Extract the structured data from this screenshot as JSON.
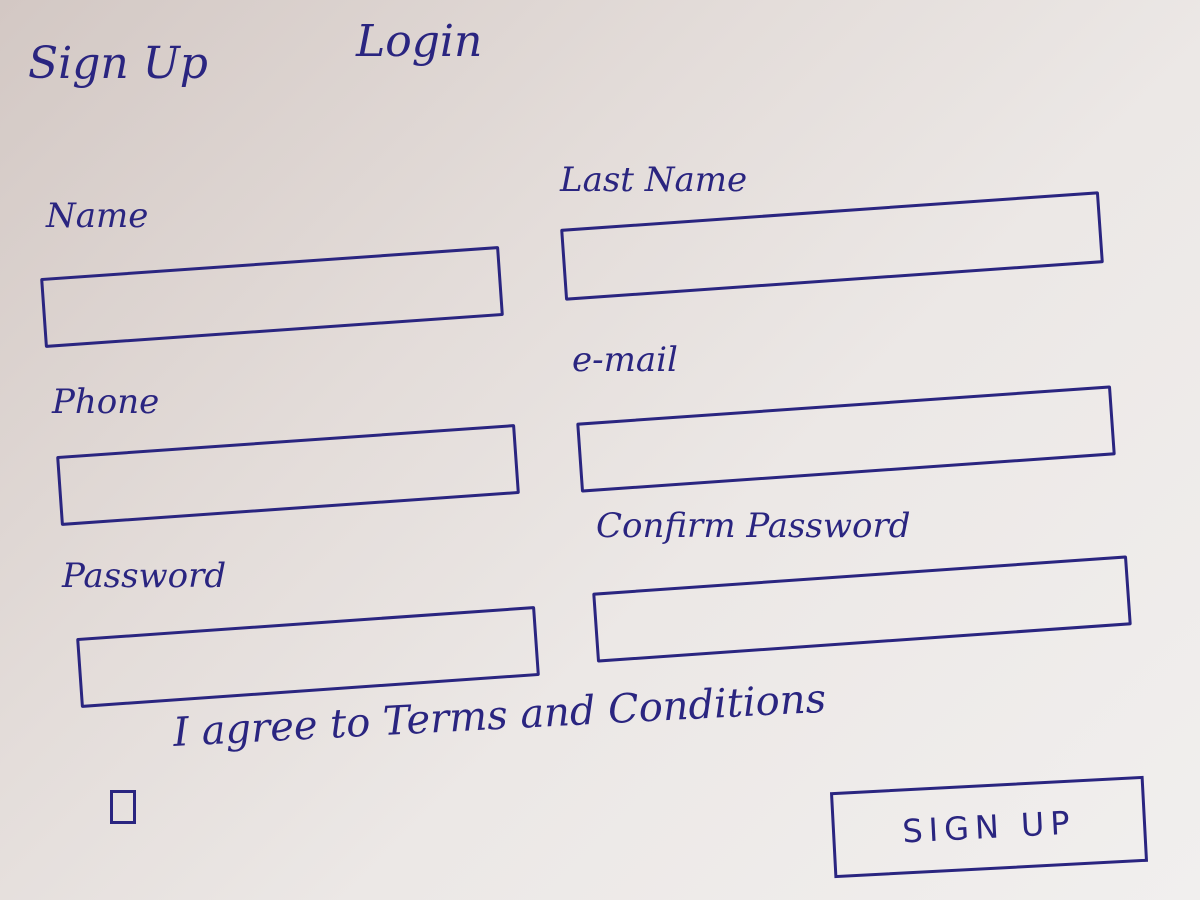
{
  "tabs": {
    "signup": "Sign Up",
    "login": "Login"
  },
  "fields": {
    "name": {
      "label": "Name",
      "value": ""
    },
    "last_name": {
      "label": "Last Name",
      "value": ""
    },
    "phone": {
      "label": "Phone",
      "value": ""
    },
    "email": {
      "label": "e-mail",
      "value": ""
    },
    "password": {
      "label": "Password",
      "value": ""
    },
    "confirm_password": {
      "label": "Confirm Password",
      "value": ""
    }
  },
  "terms": {
    "label": "I agree to Terms and Conditions",
    "checked": false
  },
  "submit_label": "SIGN UP",
  "colors": {
    "ink": "#2a2580",
    "paper": "#ece8e6"
  }
}
